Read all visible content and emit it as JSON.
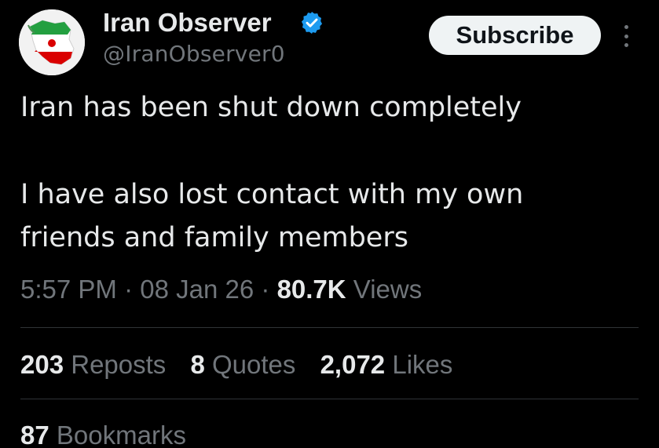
{
  "author": {
    "display_name": "Iran Observer",
    "handle": "@IranObserver0",
    "verified": true,
    "avatar_icon": "iran-map-flag-avatar"
  },
  "header": {
    "subscribe_label": "Subscribe",
    "more_icon": "more-vertical-icon"
  },
  "tweet": {
    "lines": [
      "Iran has been shut down completely",
      "I have also lost contact with my own",
      "friends and family members"
    ]
  },
  "meta": {
    "time": "5:57 PM",
    "separator": "·",
    "date": "08 Jan 26",
    "views_count": "80.7K",
    "views_label": "Views"
  },
  "stats": {
    "reposts_count": "203",
    "reposts_label": "Reposts",
    "quotes_count": "8",
    "quotes_label": "Quotes",
    "likes_count": "2,072",
    "likes_label": "Likes",
    "bookmarks_count": "87",
    "bookmarks_label": "Bookmarks"
  },
  "colors": {
    "background": "#000000",
    "primary_text": "#e7e9ea",
    "secondary_text": "#71767b",
    "verified_blue": "#1d9bf0",
    "divider": "#2f3336"
  }
}
